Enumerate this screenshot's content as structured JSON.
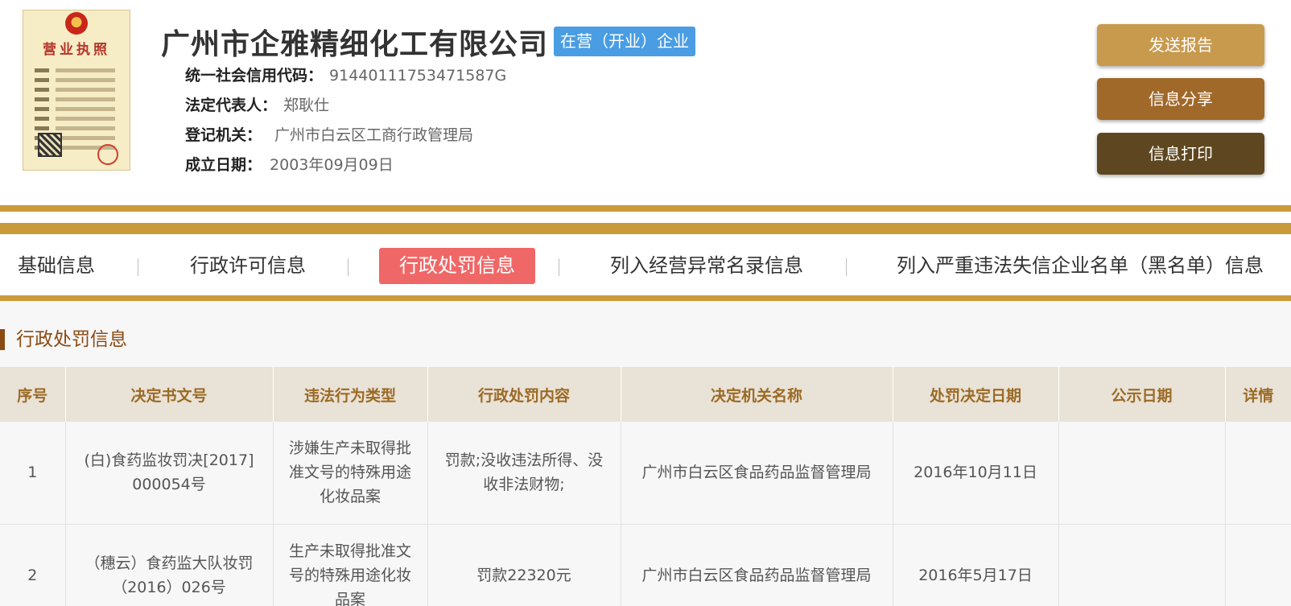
{
  "header": {
    "license_image": {
      "title": "营业执照"
    },
    "company_name": "广州市企雅精细化工有限公司",
    "status_badge": "在营（开业）企业",
    "info": [
      {
        "label": "统一社会信用代码：",
        "value": "91440111753471587G"
      },
      {
        "label": "法定代表人：",
        "value": "郑耿仕"
      },
      {
        "label": "登记机关：",
        "value": "广州市白云区工商行政管理局"
      },
      {
        "label": "成立日期：",
        "value": "2003年09月09日"
      }
    ],
    "buttons": {
      "report": "发送报告",
      "share": "信息分享",
      "print": "信息打印"
    }
  },
  "tabs": [
    {
      "label": "基础信息",
      "active": false
    },
    {
      "label": "行政许可信息",
      "active": false
    },
    {
      "label": "行政处罚信息",
      "active": true
    },
    {
      "label": "列入经营异常名录信息",
      "active": false
    },
    {
      "label": "列入严重违法失信企业名单（黑名单）信息",
      "active": false
    }
  ],
  "section": {
    "title": "行政处罚信息"
  },
  "table": {
    "headers": [
      "序号",
      "决定书文号",
      "违法行为类型",
      "行政处罚内容",
      "决定机关名称",
      "处罚决定日期",
      "公示日期",
      "详情"
    ],
    "rows": [
      [
        "1",
        "(白)食药监妆罚决[2017]000054号",
        "涉嫌生产未取得批准文号的特殊用途化妆品案",
        "罚款;没收违法所得、没收非法财物;",
        "广州市白云区食品药品监督管理局",
        "2016年10月11日",
        "",
        ""
      ],
      [
        "2",
        "（穗云）食药监大队妆罚（2016）026号",
        "生产未取得批准文号的特殊用途化妆品案",
        "罚款22320元",
        "广州市白云区食品药品监督管理局",
        "2016年5月17日",
        "",
        ""
      ]
    ]
  },
  "colors": {
    "gold_band": "#c89a3a",
    "active_tab": "#f06767",
    "status_badge": "#4a9de3",
    "btn_report": "#c89a4e",
    "btn_share": "#a0692a",
    "btn_print": "#5e4720",
    "section_accent": "#8b4a12"
  }
}
